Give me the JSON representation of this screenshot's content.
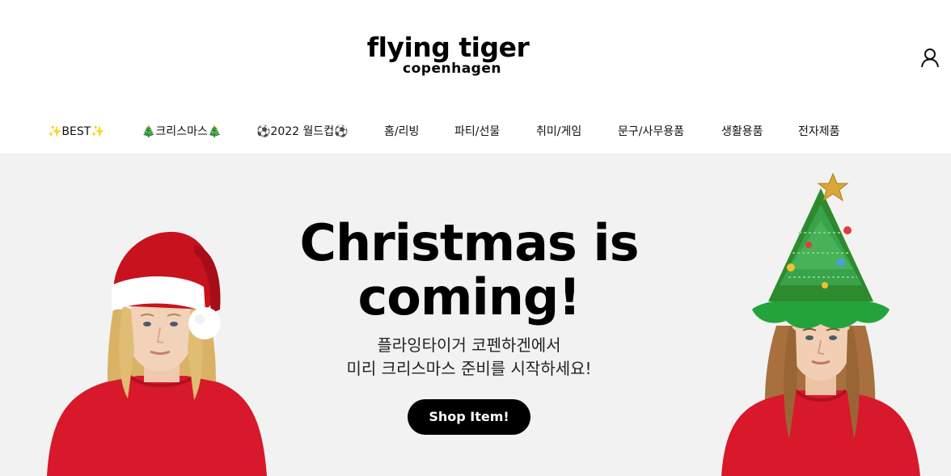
{
  "header": {
    "logo": {
      "line1": "flying tiger",
      "line2": "copenhagen"
    },
    "user_icon": "user-icon"
  },
  "nav": {
    "items": [
      {
        "label": "✨BEST✨"
      },
      {
        "label": "🎄크리스마스🎄"
      },
      {
        "label": "⚽2022 월드컵⚽"
      },
      {
        "label": "홈/리빙"
      },
      {
        "label": "파티/선물"
      },
      {
        "label": "취미/게임"
      },
      {
        "label": "문구/사무용품"
      },
      {
        "label": "생활용품"
      },
      {
        "label": "전자제품"
      }
    ]
  },
  "hero": {
    "title_line1": "Christmas is",
    "title_line2": "coming!",
    "subtitle_line1": "플라잉타이거 코펜하겐에서",
    "subtitle_line2": "미리 크리스마스 준비를 시작하세요!",
    "button_label": "Shop Item!"
  },
  "colors": {
    "hero_bg": "#f2f2f2",
    "button_bg": "#000000",
    "sweater_red": "#d7192b",
    "santa_hat_red": "#c8121e",
    "tree_green": "#2d8a2d"
  }
}
